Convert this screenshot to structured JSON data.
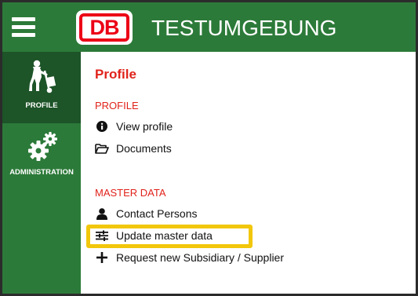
{
  "header": {
    "logo_text": "DB",
    "title": "TESTUMGEBUNG",
    "menu_icon": "hamburger-icon",
    "brand_color": "#2c7a39",
    "logo_color": "#ec0016"
  },
  "sidebar": {
    "items": [
      {
        "label": "PROFILE",
        "icon": "hand-truck-person-icon",
        "active": true
      },
      {
        "label": "ADMINISTRATION",
        "icon": "gears-icon",
        "active": false
      }
    ]
  },
  "main": {
    "title": "Profile",
    "sections": [
      {
        "heading": "PROFILE",
        "items": [
          {
            "label": "View profile",
            "icon": "info-circle-icon"
          },
          {
            "label": "Documents",
            "icon": "folder-open-icon"
          }
        ]
      },
      {
        "heading": "MASTER DATA",
        "items": [
          {
            "label": "Contact Persons",
            "icon": "user-icon"
          },
          {
            "label": "Update master data",
            "icon": "sliders-icon",
            "highlighted": true
          },
          {
            "label": "Request new Subsidiary / Supplier",
            "icon": "plus-icon"
          }
        ]
      }
    ],
    "accent_color": "#e0231b",
    "highlight_color": "#f2c70b"
  }
}
